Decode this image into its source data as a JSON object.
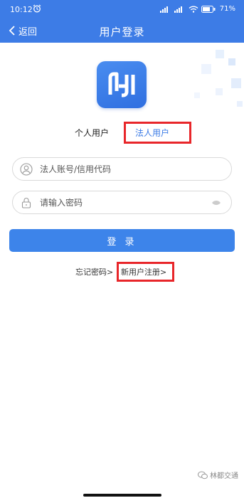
{
  "status_bar": {
    "time": "10:12",
    "battery": "71"
  },
  "nav": {
    "back_label": "返回",
    "title": "用户登录"
  },
  "tabs": {
    "personal": "个人用户",
    "legal": "法人用户"
  },
  "form": {
    "account_placeholder": "法人账号/信用代码",
    "password_placeholder": "请输入密码",
    "login_label": "登 录"
  },
  "links": {
    "forgot": "忘记密码>",
    "register": "新用户注册>"
  },
  "watermark": {
    "text": "林都交通"
  },
  "colors": {
    "brand": "#3d7ce6",
    "highlight": "#e8262a"
  },
  "icons": [
    "alarm-icon",
    "signal-icon",
    "wifi-icon",
    "battery-icon",
    "back-chevron-icon",
    "app-logo",
    "user-icon",
    "lock-icon",
    "eye-icon"
  ]
}
